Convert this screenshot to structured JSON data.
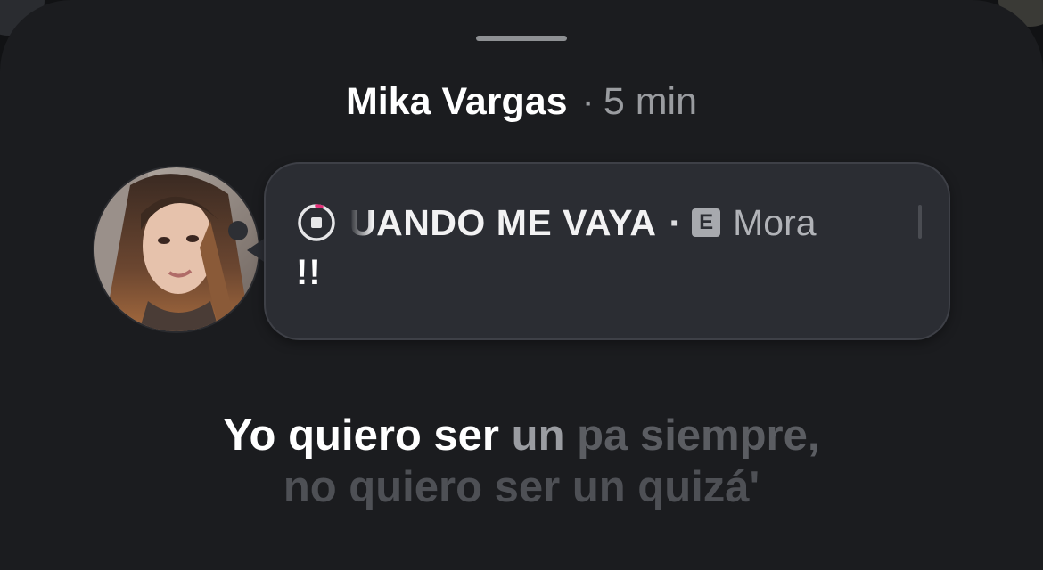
{
  "header": {
    "name": "Mika Vargas",
    "separator": "·",
    "time": "5 min"
  },
  "note": {
    "music": {
      "title": "UANDO ME VAYA",
      "separator": "·",
      "explicit_badge": "E",
      "artist": "Mora"
    },
    "text": "!!"
  },
  "lyrics": {
    "line1_sung": "Yo quiero ser",
    "line1_current": "un",
    "line1_upcoming": "pa siempre,",
    "line2": "no quiero ser un quizá'"
  },
  "colors": {
    "sheet_background": "#1b1c1f",
    "bubble_background": "#2b2d33",
    "progress_accent": "#e4307a"
  }
}
